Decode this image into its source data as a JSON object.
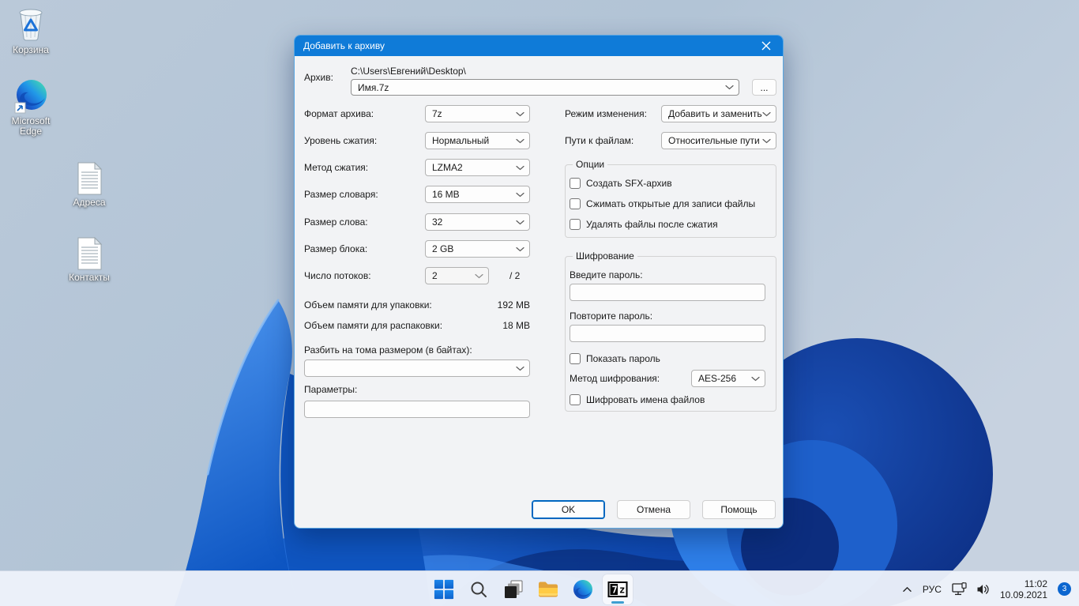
{
  "colors": {
    "titlebar_blue": "#0f7bd8",
    "accent_blue": "#0067c0",
    "taskbar_indicator": "#3d9ed1",
    "badge_blue": "#0b66d0",
    "wallpaper_bloom_blue": "#1e63d0"
  },
  "desktop": {
    "icons": [
      {
        "name": "recycle-bin",
        "label": "Корзина"
      },
      {
        "name": "microsoft-edge",
        "label": "Microsoft Edge"
      },
      {
        "name": "addresses-document",
        "label": "Адреса"
      },
      {
        "name": "contacts-document",
        "label": "Контакты"
      }
    ]
  },
  "dialog": {
    "title": "Добавить к архиву",
    "archive_label": "Архив:",
    "archive_dir": "C:\\Users\\Евгений\\Desktop\\",
    "archive_name": "Имя.7z",
    "browse": "...",
    "rows": [
      {
        "label": "Формат архива:",
        "value": "7z"
      },
      {
        "label": "Уровень сжатия:",
        "value": "Нормальный"
      },
      {
        "label": "Метод сжатия:",
        "value": "LZMA2"
      },
      {
        "label": "Размер словаря:",
        "value": "16 MB"
      },
      {
        "label": "Размер слова:",
        "value": "32"
      },
      {
        "label": "Размер блока:",
        "value": "2 GB"
      },
      {
        "label": "Число потоков:",
        "value": "2",
        "suffix": "/ 2"
      }
    ],
    "memory_pack_label": "Объем памяти для упаковки:",
    "memory_pack_value": "192 MB",
    "memory_unpack_label": "Объем памяти для распаковки:",
    "memory_unpack_value": "18 MB",
    "split_label": "Разбить на тома размером (в байтах):",
    "split_value": "",
    "params_label": "Параметры:",
    "params_value": "",
    "update_mode_label": "Режим изменения:",
    "update_mode_value": "Добавить и заменить",
    "paths_label": "Пути к файлам:",
    "paths_value": "Относительные пути",
    "options_title": "Опции",
    "options": [
      {
        "label": "Создать SFX-архив",
        "checked": false
      },
      {
        "label": "Сжимать открытые для записи файлы",
        "checked": false
      },
      {
        "label": "Удалять файлы после сжатия",
        "checked": false
      }
    ],
    "encryption_title": "Шифрование",
    "enter_password_label": "Введите пароль:",
    "repeat_password_label": "Повторите пароль:",
    "show_password_label": "Показать пароль",
    "enc_method_label": "Метод шифрования:",
    "enc_method_value": "AES-256",
    "encrypt_names_label": "Шифровать имена файлов",
    "ok": "OK",
    "cancel": "Отмена",
    "help": "Помощь"
  },
  "taskbar": {
    "icons": [
      "start",
      "search",
      "task-view",
      "file-explorer",
      "edge",
      "7-zip"
    ],
    "active_icon": "7-zip",
    "tray": {
      "language": "РУС",
      "time": "11:02",
      "date": "10.09.2021",
      "badge": "3"
    }
  }
}
